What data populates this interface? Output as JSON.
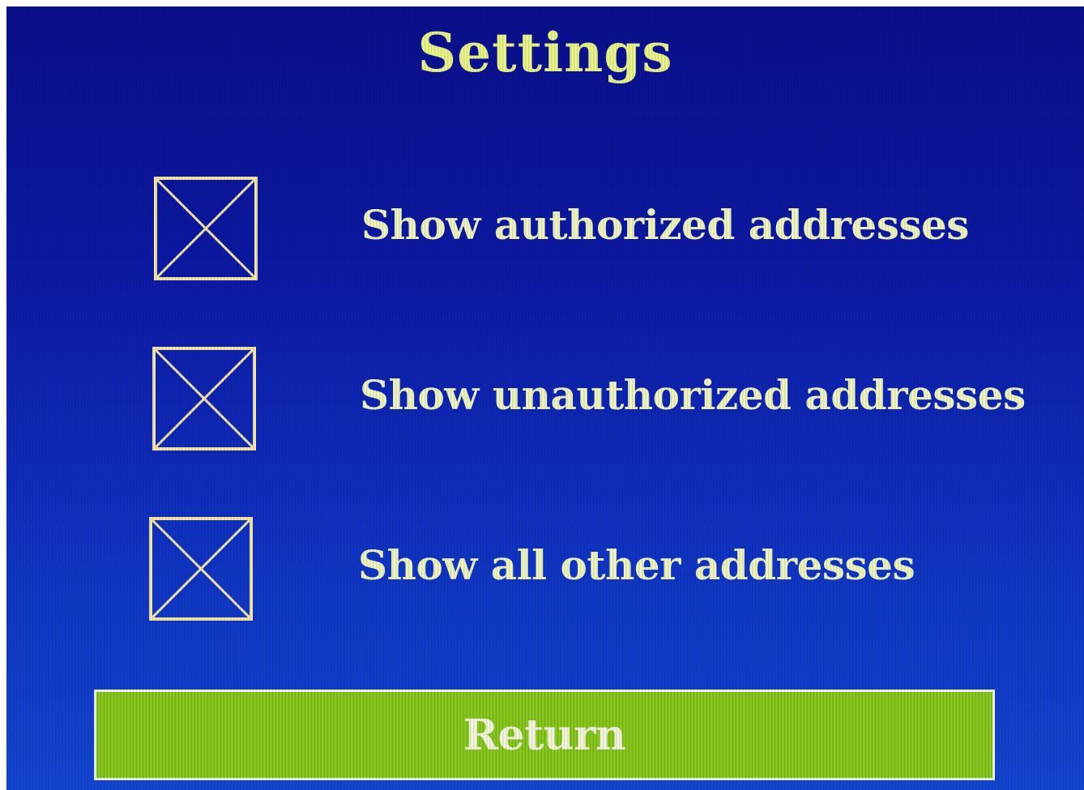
{
  "screen": {
    "title": "Settings"
  },
  "options": [
    {
      "label": "Show authorized addresses",
      "checked": true,
      "icon": "x-mark-icon"
    },
    {
      "label": "Show unauthorized addresses",
      "checked": true,
      "icon": "x-mark-icon"
    },
    {
      "label": "Show all other addresses",
      "checked": true,
      "icon": "x-mark-icon"
    }
  ],
  "return_button": {
    "label": "Return"
  },
  "colors": {
    "background": "#0d1aa6",
    "title_text": "#e9f58a",
    "label_text": "#eef5c0",
    "checkbox_stroke": "#f3e6a8",
    "button_fill": "#86c51f",
    "button_border": "#f0f6e8"
  }
}
